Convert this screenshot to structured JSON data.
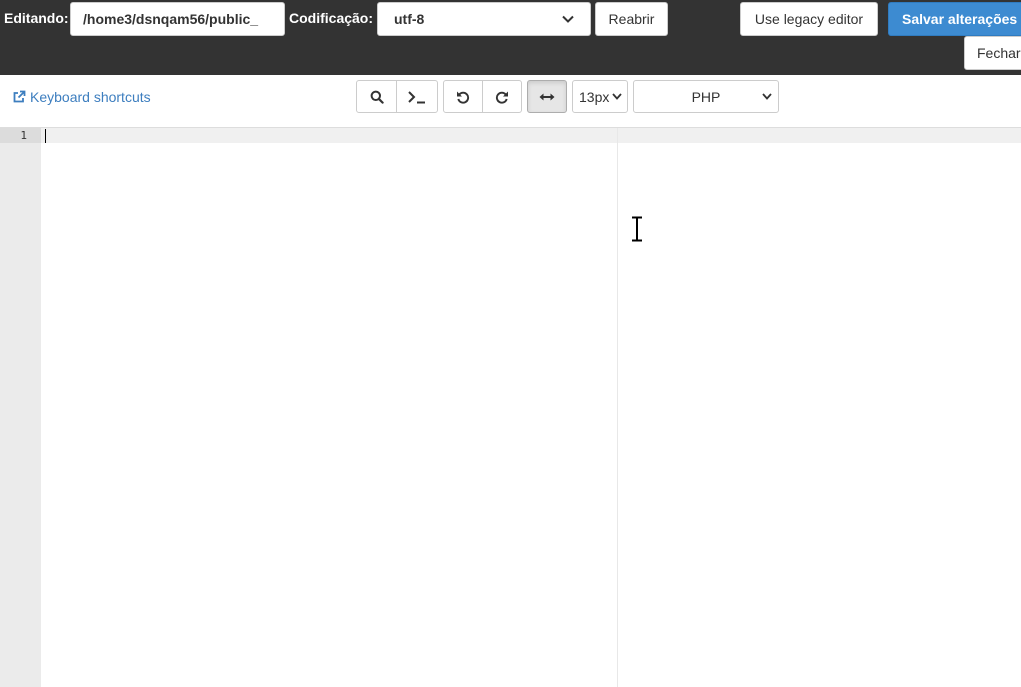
{
  "topbar": {
    "editing_label": "Editando:",
    "file_path": "/home3/dsnqam56/public_",
    "encoding_label": "Codificação:",
    "encoding_value": "utf-8",
    "reopen_label": "Reabrir",
    "legacy_label": "Use legacy editor",
    "save_label": "Salvar alterações",
    "close_label": "Fechar"
  },
  "toolbar": {
    "keyboard_shortcuts": "Keyboard shortcuts",
    "font_size": "13px",
    "mode": "PHP",
    "icons": [
      "external-link-icon",
      "search-icon",
      "terminal-icon",
      "undo-icon",
      "redo-icon",
      "wrap-icon",
      "chevron-down-icon"
    ]
  },
  "editor": {
    "line_numbers": [
      "1"
    ],
    "content": ""
  },
  "colors": {
    "topbar_bg": "#333333",
    "primary": "#3d8bd1",
    "link": "#3d7ebf",
    "gutter": "#ebebeb"
  }
}
